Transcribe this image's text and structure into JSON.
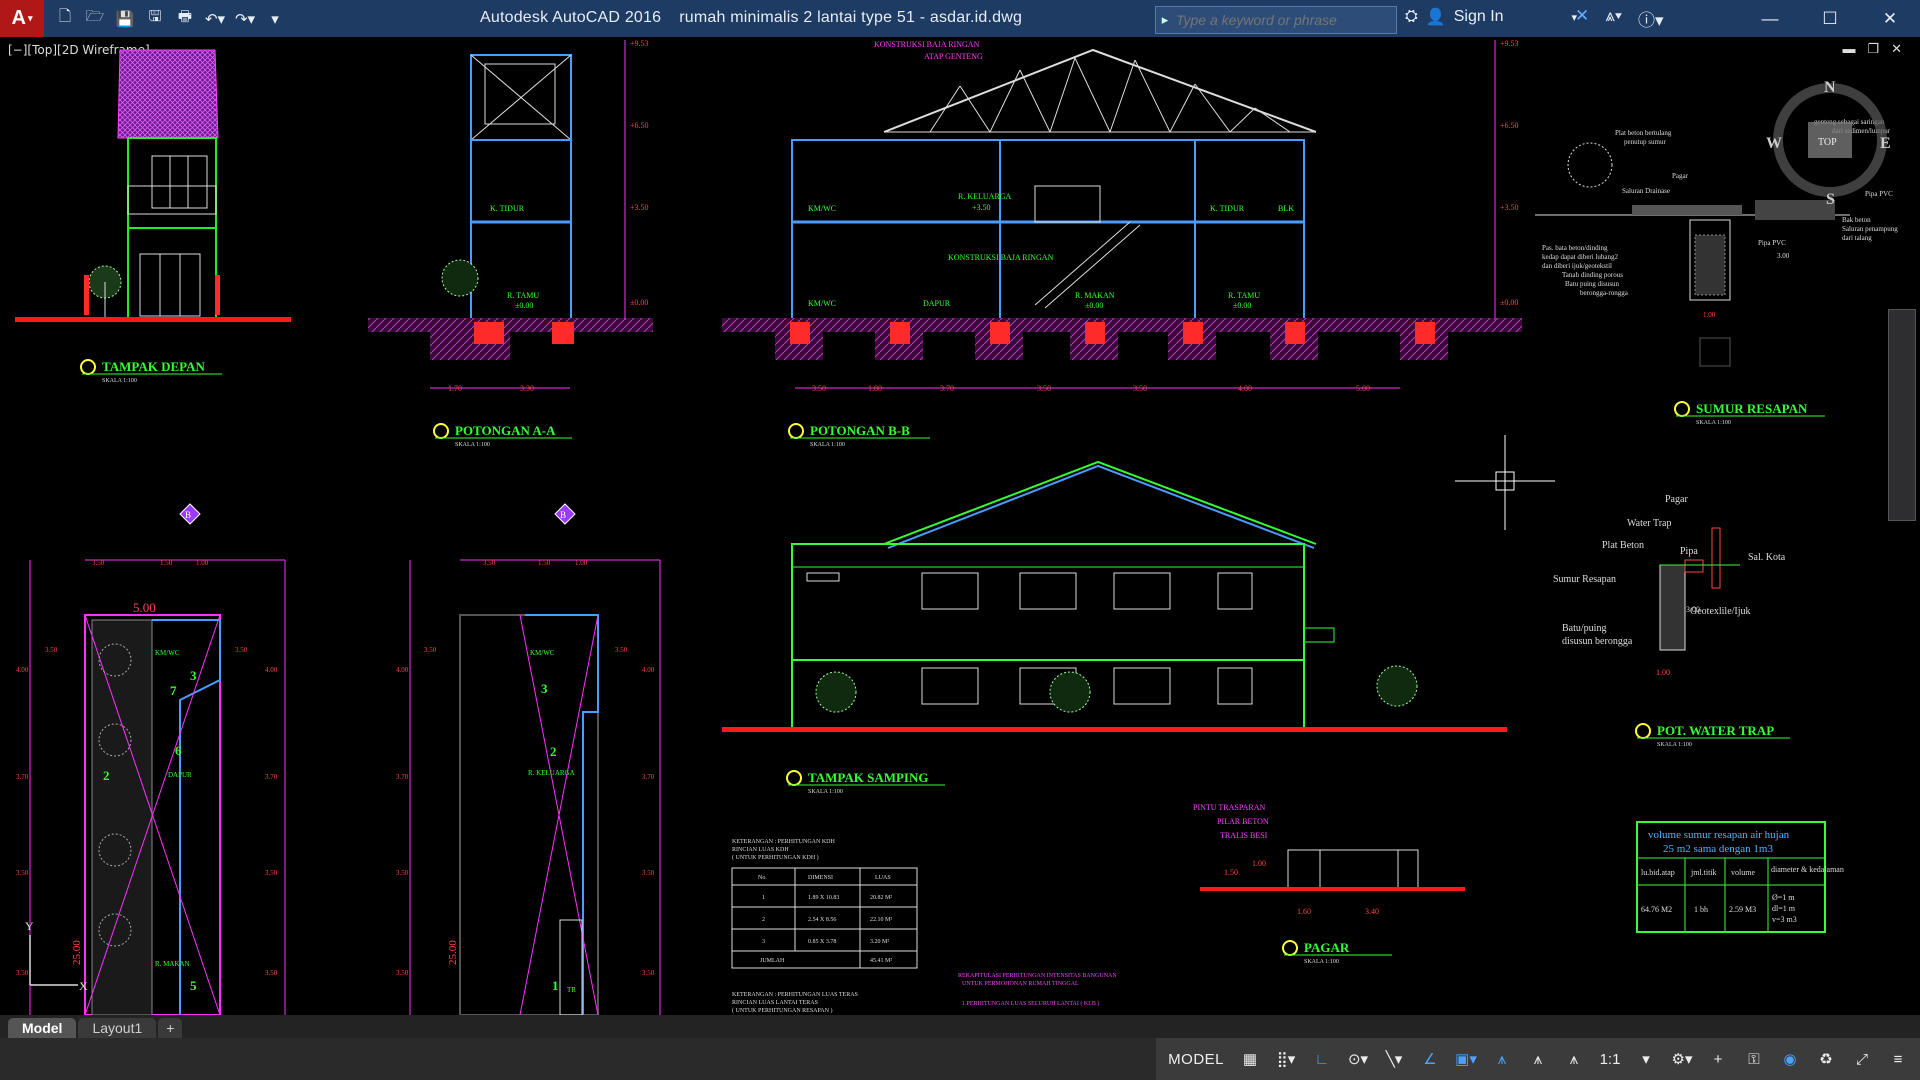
{
  "app": {
    "logo": "A",
    "title": "Autodesk AutoCAD 2016",
    "file": "rumah minimalis 2 lantai type 51 - asdar.id.dwg"
  },
  "qat_icons": [
    "new-icon",
    "open-icon",
    "save-icon",
    "saveas-icon",
    "plot-icon",
    "undo-icon",
    "redo-icon"
  ],
  "search": {
    "placeholder": "Type a keyword or phrase"
  },
  "user": {
    "sign_in": "Sign In"
  },
  "viewport": {
    "label": "[−][Top][2D Wireframe]",
    "compass": {
      "n": "N",
      "e": "E",
      "s": "S",
      "w": "W",
      "top": "TOP"
    }
  },
  "drawing": {
    "titles": {
      "tampak_depan": "TAMPAK DEPAN",
      "potongan_aa": "POTONGAN A-A",
      "potongan_bb": "POTONGAN B-B",
      "sumur_resapan": "SUMUR RESAPAN",
      "tampak_samping": "TAMPAK SAMPING",
      "pot_water_trap": "POT. WATER TRAP",
      "pagar": "PAGAR",
      "skala": "SKALA 1:100"
    },
    "roof_labels": [
      "KONSTRUKSI BAJA RINGAN",
      "ATAP GENTENG"
    ],
    "room_labels_bb": [
      "KM/WC",
      "R. KELUARGA",
      "+3.50",
      "K. TIDUR",
      "BLK",
      "KM/WC",
      "DAPUR",
      "R. MAKAN",
      "±0.00",
      "R. TAMU",
      "±0.00",
      "KONSTRUKSI BAJA RINGAN"
    ],
    "room_labels_aa": [
      "K. TIDUR",
      "R. TAMU",
      "±0.00"
    ],
    "elevations": [
      "+9.53",
      "+6.50",
      "+3.50",
      "±0.00"
    ],
    "dims_bb": [
      "3.50",
      "1.80",
      "3.70",
      "3.50",
      "3.50",
      "4.00",
      "5.00"
    ],
    "dims_aa": [
      "1.70",
      "3.30"
    ],
    "plan_dims": [
      "3.50",
      "1.50",
      "1.00",
      "5.00",
      "3.50",
      "4.00",
      "3.70",
      "3.50",
      "3.50",
      "25.00"
    ],
    "plan_room_labels": [
      "KM/WC",
      "DAPUR",
      "R. MAKAN",
      "R. KELUARGA",
      "TR"
    ],
    "section_markers": [
      "B",
      "B"
    ],
    "sumur_notes": [
      "Plat beton bertulang",
      "penutup sumur",
      "Pagar",
      "Saluran Drainase",
      "Pas. bata beton/dinding",
      "kedap dapat diberi lubang2",
      "dan diberi ijuk/geotekstil",
      "Tanah dinding porous",
      "Batu puing disusun",
      "berongga-rongga",
      "Pipa PVC",
      "Pipa PVC",
      "Bak beton",
      "Saluran penampung",
      "dari talang",
      "genteng sebagai saringan",
      "dari sedimen/lumpur",
      "1.00",
      "3.00"
    ],
    "water_trap_labels": [
      "Pagar",
      "Water Trap",
      "Plat Beton",
      "Pipa",
      "Sal. Kota",
      "Sumur Resapan",
      "Geotexlile/Ijuk",
      "Batu/puing",
      "disusun berongga",
      "1.00",
      "3.00"
    ],
    "pagar_labels": [
      "PINTU TRASPARAN",
      "PILAR BETON",
      "TRALIS BESI",
      "1.00",
      "1.50",
      "1.60",
      "3.40"
    ],
    "volume_table": {
      "title1": "volume sumur resapan air hujan",
      "title2": "25 m2 sama dengan 1m3",
      "headers": [
        "lu.bid.atap",
        "jml.titik",
        "volume",
        "diameter & kedalaman"
      ],
      "row": [
        "64.76 M2",
        "1 bh",
        "2.59 M3",
        "Ø=1 m",
        "dl=1 m",
        "v=3 m3"
      ]
    },
    "kdh_table": {
      "notes": [
        "KETERANGAN : PERHITUNGAN KDH",
        "RINCIAN LUAS KDH",
        "( UNTUK PERHITUNGAN KDH )"
      ],
      "headers": [
        "No.",
        "DIMENSI",
        "LUAS"
      ],
      "rows": [
        [
          "1",
          "1.89 X 10.83",
          "20.82 M²"
        ],
        [
          "2",
          "2.54 X 8.56",
          "22.10 M²"
        ],
        [
          "3",
          "0.85 X 3.78",
          "3.20 M²"
        ]
      ],
      "total": [
        "JUMLAH",
        "45.41 M²"
      ],
      "notes2": [
        "KETERANGAN : PERHITUNGAN LUAS TERAS",
        "RINCIAN LUAS LANTAI TERAS",
        "( UNTUK PERHITUNGAN RESAPAN )"
      ]
    },
    "rekap": [
      "REKAPITULASI PERHITUNGAN INTENSITAS BANGUNAN",
      "UNTUK PERMOHONAN RUMAH TINGGAL",
      "1.PERHITUNGAN LUAS SELURUH LANTAI ( KLB )"
    ]
  },
  "tabs": [
    "Model",
    "Layout1",
    "+"
  ],
  "status": {
    "model": "MODEL",
    "scale": "1:1"
  }
}
